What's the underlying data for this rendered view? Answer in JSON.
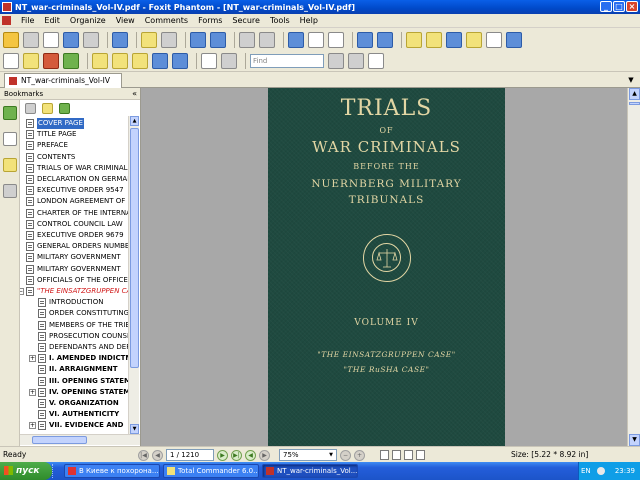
{
  "window": {
    "title": "NT_war-criminals_Vol-IV.pdf - Foxit Phantom - [NT_war-criminals_Vol-IV.pdf]"
  },
  "menu": [
    "File",
    "Edit",
    "Organize",
    "View",
    "Comments",
    "Forms",
    "Secure",
    "Tools",
    "Help"
  ],
  "toolbar": {
    "find_placeholder": "Find"
  },
  "tabs": {
    "active": "NT_war-criminals_Vol-IV"
  },
  "bookmarks_panel": {
    "title": "Bookmarks",
    "items": [
      {
        "label": "COVER PAGE",
        "level": 1,
        "selected": true
      },
      {
        "label": "TITLE PAGE",
        "level": 1
      },
      {
        "label": "PREFACE",
        "level": 1
      },
      {
        "label": "CONTENTS",
        "level": 1
      },
      {
        "label": "TRIALS OF WAR CRIMINALS",
        "level": 1
      },
      {
        "label": "DECLARATION ON GERMAN",
        "level": 1
      },
      {
        "label": "EXECUTIVE ORDER 9547",
        "level": 1
      },
      {
        "label": "LONDON AGREEMENT OF",
        "level": 1
      },
      {
        "label": "CHARTER OF THE INTERNATIONAL",
        "level": 1
      },
      {
        "label": "CONTROL COUNCIL LAW",
        "level": 1
      },
      {
        "label": "EXECUTIVE ORDER 9679",
        "level": 1
      },
      {
        "label": "GENERAL ORDERS NUMBER",
        "level": 1
      },
      {
        "label": "MILITARY GOVERNMENT",
        "level": 1
      },
      {
        "label": "MILITARY GOVERNMENT",
        "level": 1
      },
      {
        "label": "OFFICIALS OF THE OFFICE",
        "level": 1
      },
      {
        "label": "\"THE EINSATZGRUPPEN CASE\"",
        "level": 1,
        "red": true,
        "expanded": true
      },
      {
        "label": "INTRODUCTION",
        "level": 2
      },
      {
        "label": "ORDER CONSTITUTING",
        "level": 2
      },
      {
        "label": "MEMBERS OF THE TRIBUNAL",
        "level": 2
      },
      {
        "label": "PROSECUTION COUNSEL",
        "level": 2
      },
      {
        "label": "DEFENDANTS AND DEFENSE",
        "level": 2
      },
      {
        "label": "I. AMENDED INDICTMENT",
        "level": 2,
        "bold": true,
        "expandable": true
      },
      {
        "label": "II. ARRAIGNMENT",
        "level": 2,
        "bold": true
      },
      {
        "label": "III. OPENING STATEMENT",
        "level": 2,
        "bold": true
      },
      {
        "label": "IV. OPENING STATEMENTS",
        "level": 2,
        "bold": true,
        "expandable": true
      },
      {
        "label": "V. ORGANIZATION",
        "level": 2,
        "bold": true
      },
      {
        "label": "VI. AUTHENTICITY",
        "level": 2,
        "bold": true
      },
      {
        "label": "VII. EVIDENCE AND",
        "level": 2,
        "bold": true,
        "expandable": true
      }
    ]
  },
  "document": {
    "cover": {
      "title": "TRIALS",
      "of": "OF",
      "war_criminals": "WAR CRIMINALS",
      "before_the": "BEFORE THE",
      "tribunal_line1": "NUERNBERG MILITARY",
      "tribunal_line2": "TRIBUNALS",
      "seal_text": "NUERNBERG MILITARY TRIBUNALS",
      "volume": "VOLUME IV",
      "case1": "\"THE EINSATZGRUPPEN CASE\"",
      "case2": "\"THE RuSHA CASE\"",
      "colors": {
        "cloth": "#1f4a40",
        "gilt": "#e2d6a4"
      }
    }
  },
  "statusbar": {
    "ready": "Ready",
    "page": "1 / 1210",
    "zoom": "75%",
    "size": "Size: [5.22 * 8.92 in]"
  },
  "taskbar": {
    "start": "пуск",
    "buttons": [
      {
        "label": "В Киеве к похорона...",
        "active": false,
        "icon": "opera-icon"
      },
      {
        "label": "Total Commander 6.0...",
        "active": false,
        "icon": "total-commander-icon"
      },
      {
        "label": "NT_war-criminals_Vol...",
        "active": true,
        "icon": "pdf-icon"
      }
    ],
    "lang": "EN",
    "clock": "23:39"
  }
}
